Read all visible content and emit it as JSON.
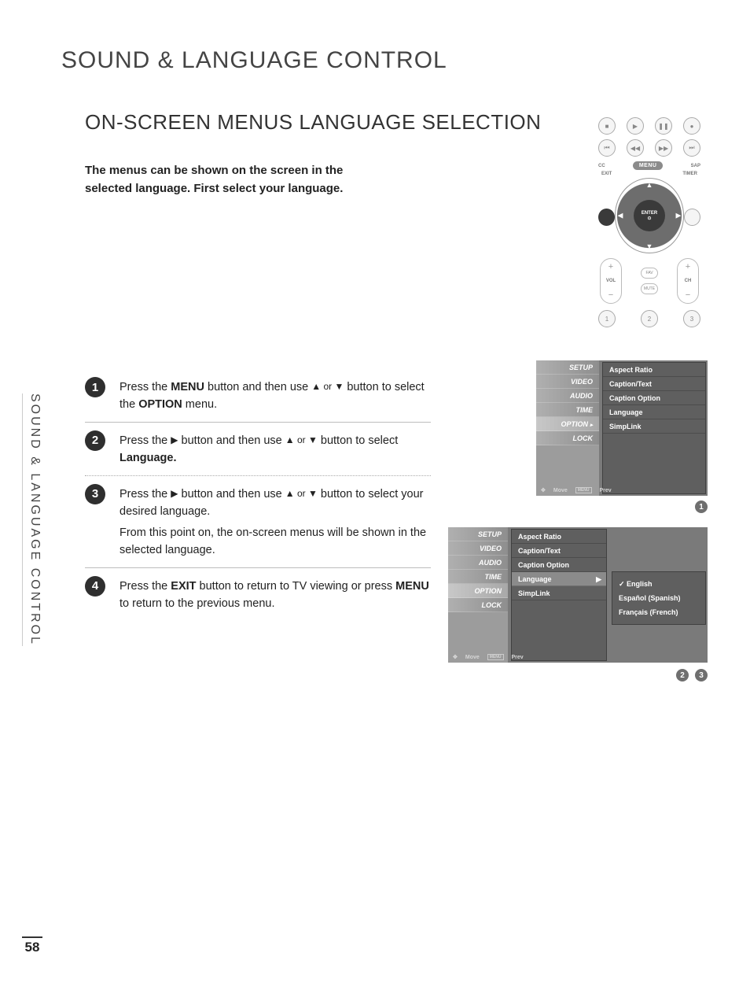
{
  "page": {
    "main_title": "SOUND & LANGUAGE CONTROL",
    "sub_title": "ON-SCREEN MENUS LANGUAGE SELECTION",
    "intro": "The menus can be shown on the screen in the selected language. First select your language.",
    "side_tab": "SOUND & LANGUAGE CONTROL",
    "page_number": "58"
  },
  "steps": [
    {
      "num": "1",
      "text_a": "Press the ",
      "b1": "MENU",
      "text_b": " button and then use ",
      "arrows": "▲ or ▼",
      "text_c": " button to select the ",
      "b2": "OPTION",
      "text_d": " menu."
    },
    {
      "num": "2",
      "text_a": "Press the ",
      "arrow_r": "▶",
      "text_b": " button and then use ",
      "arrows": "▲ or ▼",
      "text_c": " button to select ",
      "b1": "Language.",
      "text_d": ""
    },
    {
      "num": "3",
      "text_a": "Press the ",
      "arrow_r": "▶",
      "text_b": " button and then use ",
      "arrows": "▲ or ▼",
      "text_c": " button to select your desired language.",
      "extra": "From this point on, the on-screen menus will be shown in the selected language."
    },
    {
      "num": "4",
      "text_a": "Press the ",
      "b1": "EXIT",
      "text_b": " button to return to TV viewing or press ",
      "b2": "MENU",
      "text_c": " to return to the previous menu."
    }
  ],
  "remote": {
    "cc": "CC",
    "sap": "SAP",
    "exit": "EXIT",
    "timer": "TIMER",
    "menu": "MENU",
    "enter": "ENTER",
    "vol": "VOL",
    "ch": "CH",
    "fav": "FAV",
    "mute": "MUTE",
    "nums": [
      "1",
      "2",
      "3"
    ]
  },
  "osd": {
    "tabs": [
      "SETUP",
      "VIDEO",
      "AUDIO",
      "TIME",
      "OPTION",
      "LOCK"
    ],
    "option_items": [
      "Aspect Ratio",
      "Caption/Text",
      "Caption Option",
      "Language",
      "SimpLink"
    ],
    "footer_move": "Move",
    "footer_prev": "Prev",
    "languages": [
      {
        "label": "English",
        "selected": true
      },
      {
        "label": "Español (Spanish)",
        "selected": false
      },
      {
        "label": "Français (French)",
        "selected": false
      }
    ],
    "badges": {
      "a": "1",
      "b": "2",
      "c": "3"
    }
  }
}
